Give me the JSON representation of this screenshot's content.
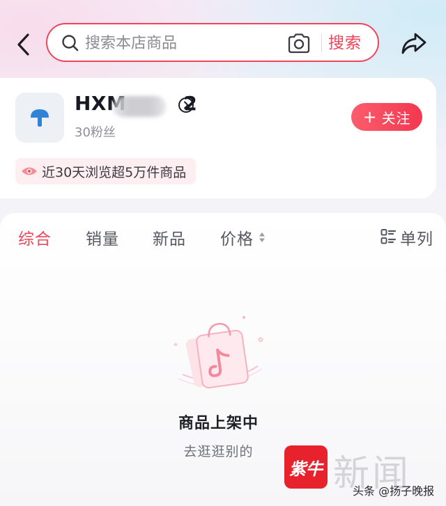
{
  "search": {
    "placeholder": "搜索本店商品",
    "button_label": "搜索"
  },
  "shop": {
    "name_prefix": "HXM",
    "name_suffix": "2",
    "fans": "30粉丝",
    "follow_label": "关注",
    "views_badge": "近30天浏览超5万件商品"
  },
  "tabs": [
    {
      "label": "综合",
      "active": true
    },
    {
      "label": "销量",
      "active": false
    },
    {
      "label": "新品",
      "active": false
    },
    {
      "label": "价格",
      "active": false
    }
  ],
  "layout_toggle": {
    "label": "单列",
    "icon": "list-layout-icon"
  },
  "empty_state": {
    "title": "商品上架中",
    "subtitle": "去逛逛别的"
  },
  "watermark": {
    "logo_text": "紫牛",
    "text": "新闻",
    "caption": "头条 @扬子晚报"
  },
  "colors": {
    "accent": "#f0445a",
    "text_primary": "#161823",
    "text_secondary": "#8f9097"
  }
}
